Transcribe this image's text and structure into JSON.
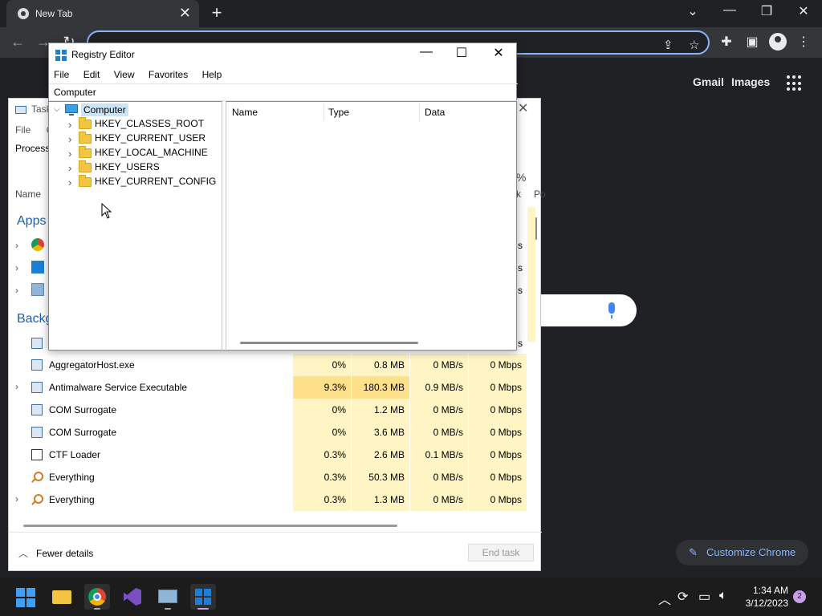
{
  "chrome": {
    "tab_title": "New Tab",
    "links": {
      "gmail": "Gmail",
      "images": "Images"
    },
    "customize_label": "Customize Chrome"
  },
  "task_manager": {
    "title": "Task",
    "menu_file": "File",
    "menu_options": "O",
    "tab_processes": "Processes",
    "col_name": "Name",
    "pct_header": "%",
    "pct_sub": "k",
    "power_header": "Po",
    "section_apps": "Apps",
    "section_background": "Backg",
    "rows": [
      {
        "name": "AggregatorHost.exe",
        "cpu": "0%",
        "memory": "0.8 MB",
        "disk": "0 MB/s",
        "network": "0 Mbps"
      },
      {
        "name": "Antimalware Service Executable",
        "cpu": "9.3%",
        "memory": "180.3 MB",
        "disk": "0.9 MB/s",
        "network": "0 Mbps"
      },
      {
        "name": "COM Surrogate",
        "cpu": "0%",
        "memory": "1.2 MB",
        "disk": "0 MB/s",
        "network": "0 Mbps"
      },
      {
        "name": "COM Surrogate",
        "cpu": "0%",
        "memory": "3.6 MB",
        "disk": "0 MB/s",
        "network": "0 Mbps"
      },
      {
        "name": "CTF Loader",
        "cpu": "0.3%",
        "memory": "2.6 MB",
        "disk": "0.1 MB/s",
        "network": "0 Mbps"
      },
      {
        "name": "Everything",
        "cpu": "0.3%",
        "memory": "50.3 MB",
        "disk": "0 MB/s",
        "network": "0 Mbps"
      },
      {
        "name": "Everything",
        "cpu": "0.3%",
        "memory": "1.3 MB",
        "disk": "0 MB/s",
        "network": "0 Mbps"
      }
    ],
    "partial_s": "s",
    "fewer_details": "Fewer details",
    "end_task": "End task"
  },
  "registry_editor": {
    "title": "Registry Editor",
    "menu": [
      "File",
      "Edit",
      "View",
      "Favorites",
      "Help"
    ],
    "address": "Computer",
    "root": "Computer",
    "hives": [
      "HKEY_CLASSES_ROOT",
      "HKEY_CURRENT_USER",
      "HKEY_LOCAL_MACHINE",
      "HKEY_USERS",
      "HKEY_CURRENT_CONFIG"
    ],
    "columns": [
      "Name",
      "Type",
      "Data"
    ]
  },
  "taskbar": {
    "time": "1:34 AM",
    "date": "3/12/2023",
    "notification_count": "2"
  },
  "colors": {
    "chrome_dark": "#202124",
    "chrome_toolbar": "#35363a",
    "omnibox_focus": "#8ab4f8",
    "taskmgr_heat_light": "#fff4c4",
    "taskmgr_heat_strong": "#ffe08a",
    "regedit_selection": "#cce4f7",
    "taskbar": "#1c1c1c"
  }
}
